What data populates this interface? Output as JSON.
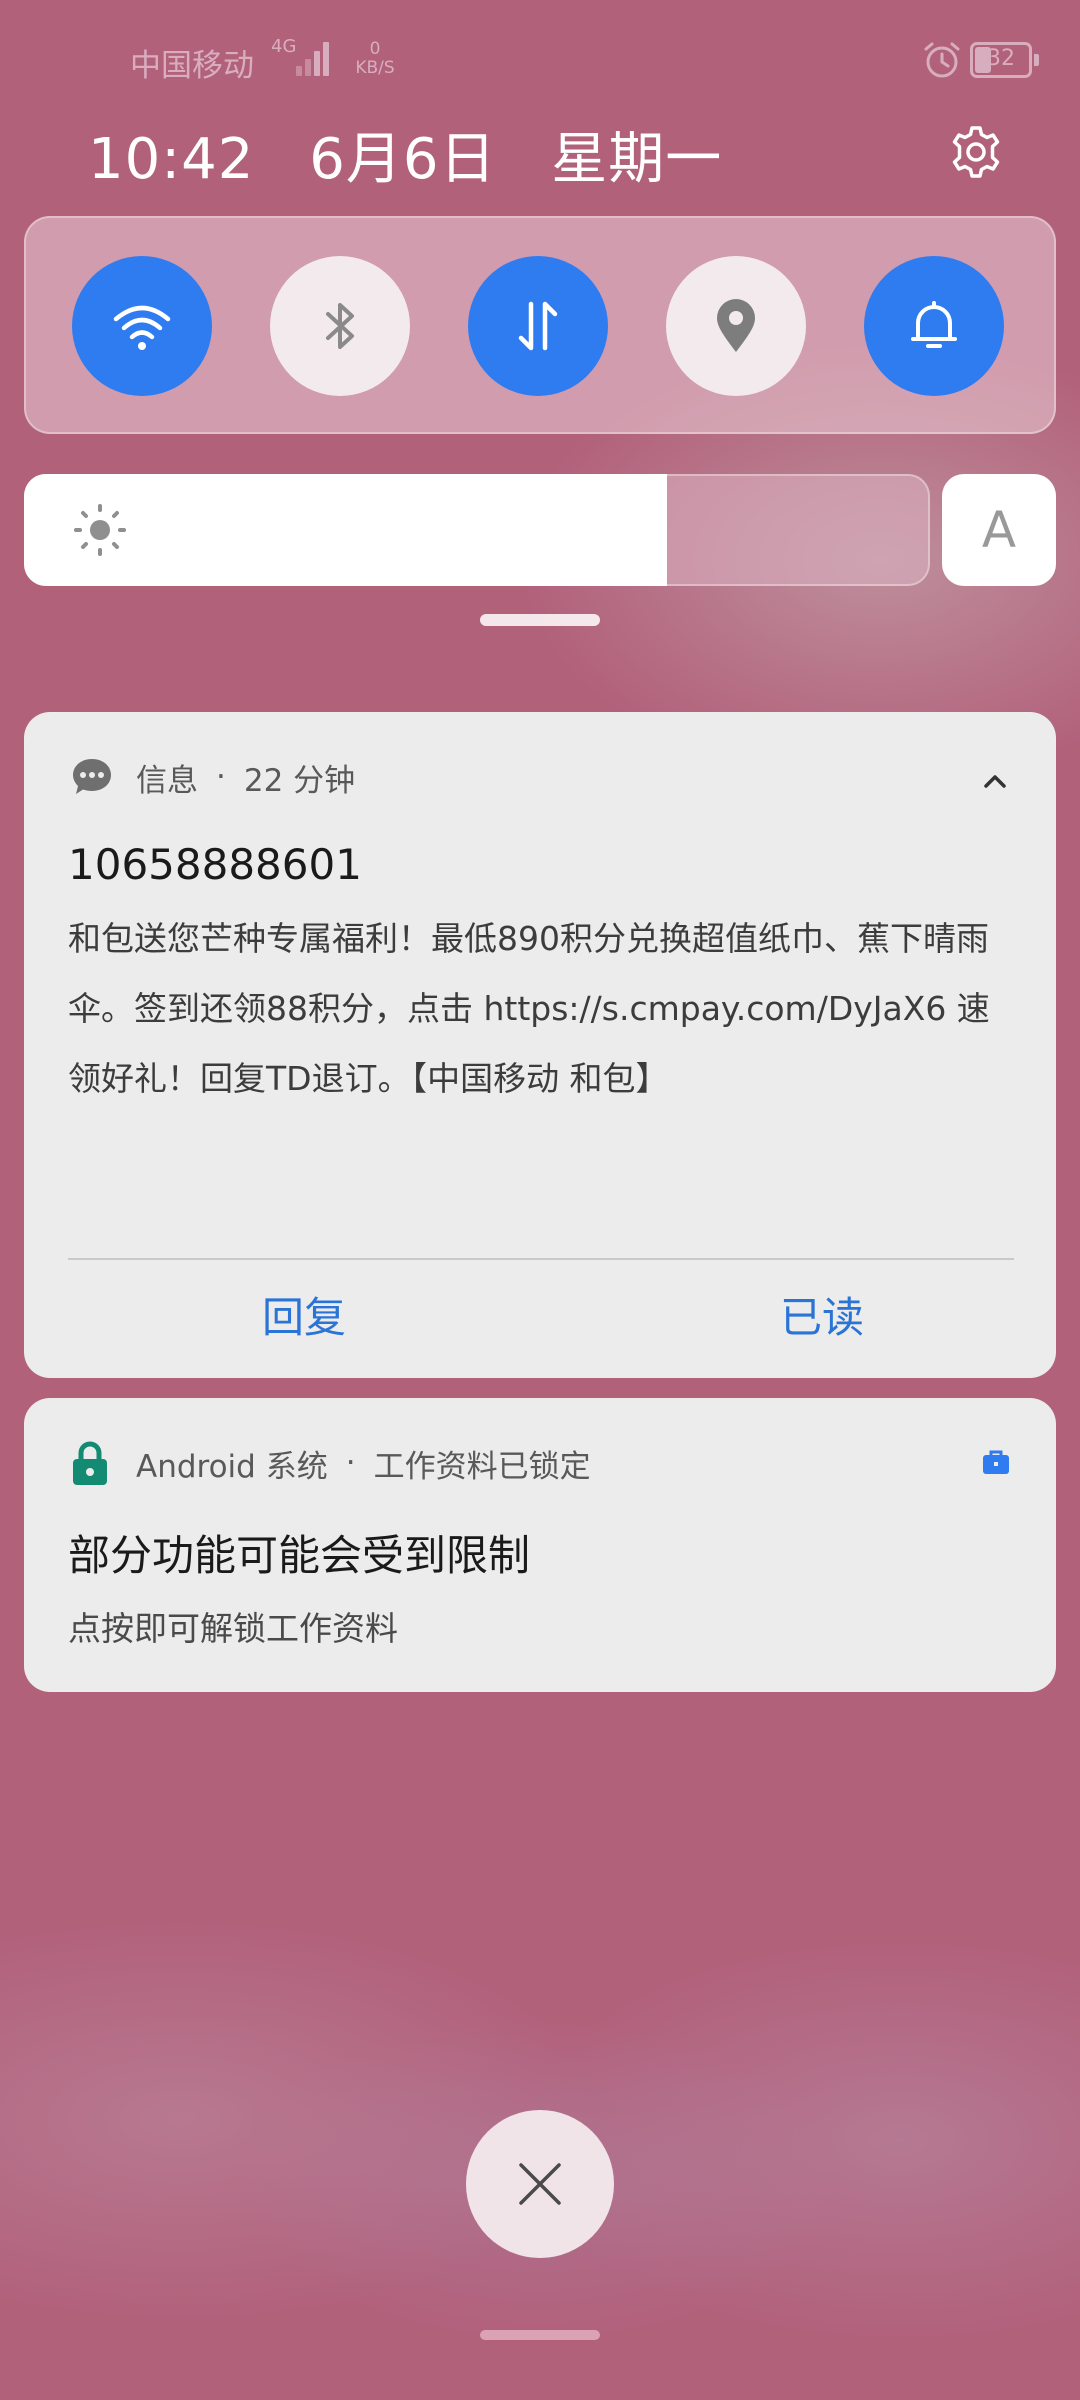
{
  "status_bar": {
    "carrier": "中国移动",
    "network_type": "4G",
    "speed_value": "0",
    "speed_unit": "KB/S",
    "battery_level": "32"
  },
  "header": {
    "time": "10:42",
    "date": "6月6日",
    "weekday": "星期一"
  },
  "quick_settings": {
    "toggles": [
      {
        "name": "wifi",
        "icon": "wifi-icon",
        "state": "on"
      },
      {
        "name": "bluetooth",
        "icon": "bluetooth-icon",
        "state": "off"
      },
      {
        "name": "mobile-data",
        "icon": "data-transfer-icon",
        "state": "on"
      },
      {
        "name": "location",
        "icon": "location-pin-icon",
        "state": "off"
      },
      {
        "name": "sound",
        "icon": "bell-icon",
        "state": "on"
      }
    ],
    "brightness_level": 0.71,
    "auto_brightness_label": "A",
    "accent_color": "#2e7cf0"
  },
  "notifications": {
    "message": {
      "app_name": "信息",
      "time_ago": "22 分钟",
      "sender": "10658888601",
      "body": "和包送您芒种专属福利！最低890积分兑换超值纸巾、蕉下晴雨伞。签到还领88积分，点击 https://s.cmpay.com/DyJaX6 速领好礼！回复TD退订。【中国移动 和包】",
      "actions": {
        "reply": "回复",
        "mark_read": "已读"
      },
      "action_color": "#2a74d6"
    },
    "android": {
      "app_name": "Android 系统",
      "subtitle": "工作资料已锁定",
      "title": "部分功能可能会受到限制",
      "text": "点按即可解锁工作资料",
      "icon_color": "#138a72",
      "badge_color": "#2e7cf0"
    }
  }
}
